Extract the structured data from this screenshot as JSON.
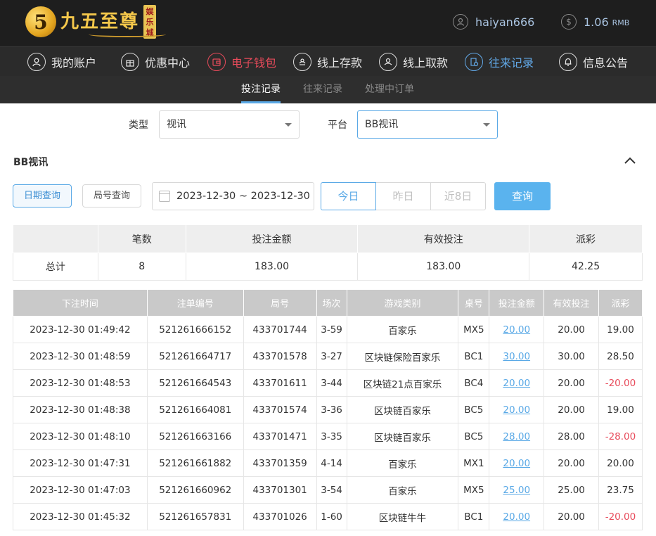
{
  "header": {
    "logo_digit": "5",
    "logo_text": "九五至尊",
    "logo_stamp": "娱乐城",
    "username": "haiyan666",
    "balance": "1.06",
    "currency": "RMB"
  },
  "nav": {
    "items": [
      {
        "label": "我的账户",
        "icon": "user-icon"
      },
      {
        "label": "优惠中心",
        "icon": "gift-icon"
      },
      {
        "label": "电子钱包",
        "icon": "wallet-icon"
      },
      {
        "label": "线上存款",
        "icon": "deposit-icon"
      },
      {
        "label": "线上取款",
        "icon": "withdraw-icon"
      },
      {
        "label": "往来记录",
        "icon": "records-icon"
      },
      {
        "label": "信息公告",
        "icon": "bell-icon"
      }
    ],
    "highlight_red": "电子钱包",
    "highlight_blue": "往来记录"
  },
  "subnav": {
    "tabs": [
      "投注记录",
      "往来记录",
      "处理中订单"
    ],
    "active": "投注记录"
  },
  "filters": {
    "type_label": "类型",
    "type_value": "视讯",
    "platform_label": "平台",
    "platform_value": "BB视讯"
  },
  "section": {
    "title": "BB视讯"
  },
  "query": {
    "date_query": "日期查询",
    "round_query": "局号查询",
    "date_range": "2023-12-30 ~ 2023-12-30",
    "ranges": [
      "今日",
      "昨日",
      "近8日"
    ],
    "active_range": "今日",
    "search": "查询"
  },
  "summary": {
    "headers": [
      "",
      "笔数",
      "投注金额",
      "有效投注",
      "派彩"
    ],
    "row": [
      "总计",
      "8",
      "183.00",
      "183.00",
      "42.25"
    ]
  },
  "detail": {
    "headers": [
      "下注时间",
      "注单编号",
      "局号",
      "场次",
      "游戏类别",
      "桌号",
      "投注金额",
      "有效投注",
      "派彩"
    ],
    "rows": [
      [
        "2023-12-30 01:49:42",
        "521261666152",
        "433701744",
        "3-59",
        "百家乐",
        "MX5",
        "20.00",
        "20.00",
        "19.00"
      ],
      [
        "2023-12-30 01:48:59",
        "521261664717",
        "433701578",
        "3-27",
        "区块链保险百家乐",
        "BC1",
        "30.00",
        "30.00",
        "28.50"
      ],
      [
        "2023-12-30 01:48:53",
        "521261664543",
        "433701611",
        "3-44",
        "区块链21点百家乐",
        "BC4",
        "20.00",
        "20.00",
        "-20.00"
      ],
      [
        "2023-12-30 01:48:38",
        "521261664081",
        "433701574",
        "3-36",
        "区块链百家乐",
        "BC5",
        "20.00",
        "20.00",
        "19.00"
      ],
      [
        "2023-12-30 01:48:10",
        "521261663166",
        "433701471",
        "3-35",
        "区块链百家乐",
        "BC5",
        "28.00",
        "28.00",
        "-28.00"
      ],
      [
        "2023-12-30 01:47:31",
        "521261661882",
        "433701359",
        "4-14",
        "百家乐",
        "MX1",
        "20.00",
        "20.00",
        "20.00"
      ],
      [
        "2023-12-30 01:47:03",
        "521261660962",
        "433701301",
        "3-54",
        "百家乐",
        "MX5",
        "25.00",
        "25.00",
        "23.75"
      ],
      [
        "2023-12-30 01:45:32",
        "521261657831",
        "433701026",
        "1-60",
        "区块链牛牛",
        "BC1",
        "20.00",
        "20.00",
        "-20.00"
      ]
    ]
  },
  "colors": {
    "accent": "#5aa9e6",
    "negative": "#e84b5b",
    "header_bg": "#1e1e1e"
  }
}
